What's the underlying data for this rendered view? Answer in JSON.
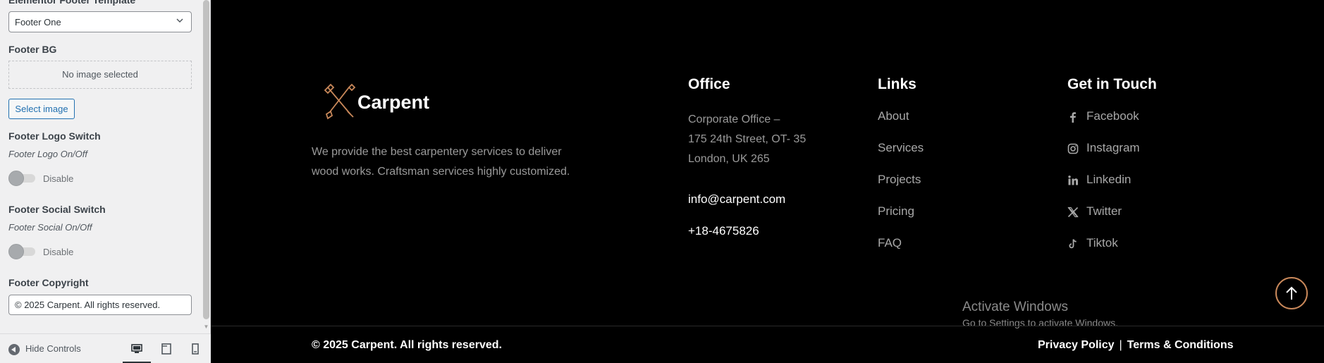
{
  "panel": {
    "cut_title": "Elementor Footer Template",
    "template_select": {
      "value": "Footer One"
    },
    "footer_bg": {
      "title": "Footer BG",
      "placeholder": "No image selected",
      "button": "Select image"
    },
    "logo_switch": {
      "title": "Footer Logo Switch",
      "desc": "Footer Logo On/Off",
      "state": "Disable"
    },
    "social_switch": {
      "title": "Footer Social Switch",
      "desc": "Footer Social On/Off",
      "state": "Disable"
    },
    "copyright_field": {
      "title": "Footer Copyright",
      "value": "© 2025 Carpent. All rights reserved."
    },
    "footer": {
      "hide_controls": "Hide Controls",
      "devices": [
        "desktop-icon",
        "tablet-icon",
        "mobile-icon"
      ]
    }
  },
  "site_footer": {
    "brand": {
      "name": "Carpent",
      "description": "We provide the best carpentery services to deliver wood works. Craftsman services highly customized."
    },
    "office": {
      "title": "Office",
      "address": [
        "Corporate Office –",
        "175 24th Street, OT- 35",
        "London, UK 265"
      ],
      "email": "info@carpent.com",
      "phone": "+18-4675826"
    },
    "links": {
      "title": "Links",
      "items": [
        "About",
        "Services",
        "Projects",
        "Pricing",
        "FAQ"
      ]
    },
    "contact": {
      "title": "Get in Touch",
      "items": [
        {
          "label": "Facebook",
          "icon": "facebook-icon"
        },
        {
          "label": "Instagram",
          "icon": "instagram-icon"
        },
        {
          "label": "Linkedin",
          "icon": "linkedin-icon"
        },
        {
          "label": "Twitter",
          "icon": "x-twitter-icon"
        },
        {
          "label": "Tiktok",
          "icon": "tiktok-icon"
        }
      ]
    },
    "copyright": "© 2025 Carpent. All rights reserved.",
    "legal": [
      "Privacy Policy",
      "|",
      "Terms & Conditions"
    ]
  },
  "windows_watermark": {
    "title": "Activate Windows",
    "subtitle": "Go to Settings to activate Windows."
  },
  "colors": {
    "accent": "#c9885a",
    "background": "#000000",
    "muted_text": "#9a9a9a"
  }
}
